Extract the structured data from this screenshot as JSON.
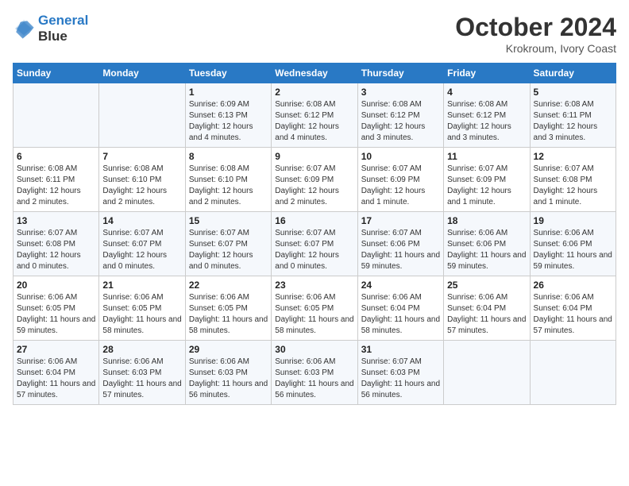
{
  "header": {
    "logo_line1": "General",
    "logo_line2": "Blue",
    "month": "October 2024",
    "location": "Krokroum, Ivory Coast"
  },
  "weekdays": [
    "Sunday",
    "Monday",
    "Tuesday",
    "Wednesday",
    "Thursday",
    "Friday",
    "Saturday"
  ],
  "weeks": [
    [
      {
        "day": "",
        "sunrise": "",
        "sunset": "",
        "daylight": ""
      },
      {
        "day": "",
        "sunrise": "",
        "sunset": "",
        "daylight": ""
      },
      {
        "day": "1",
        "sunrise": "Sunrise: 6:09 AM",
        "sunset": "Sunset: 6:13 PM",
        "daylight": "Daylight: 12 hours and 4 minutes."
      },
      {
        "day": "2",
        "sunrise": "Sunrise: 6:08 AM",
        "sunset": "Sunset: 6:12 PM",
        "daylight": "Daylight: 12 hours and 4 minutes."
      },
      {
        "day": "3",
        "sunrise": "Sunrise: 6:08 AM",
        "sunset": "Sunset: 6:12 PM",
        "daylight": "Daylight: 12 hours and 3 minutes."
      },
      {
        "day": "4",
        "sunrise": "Sunrise: 6:08 AM",
        "sunset": "Sunset: 6:12 PM",
        "daylight": "Daylight: 12 hours and 3 minutes."
      },
      {
        "day": "5",
        "sunrise": "Sunrise: 6:08 AM",
        "sunset": "Sunset: 6:11 PM",
        "daylight": "Daylight: 12 hours and 3 minutes."
      }
    ],
    [
      {
        "day": "6",
        "sunrise": "Sunrise: 6:08 AM",
        "sunset": "Sunset: 6:11 PM",
        "daylight": "Daylight: 12 hours and 2 minutes."
      },
      {
        "day": "7",
        "sunrise": "Sunrise: 6:08 AM",
        "sunset": "Sunset: 6:10 PM",
        "daylight": "Daylight: 12 hours and 2 minutes."
      },
      {
        "day": "8",
        "sunrise": "Sunrise: 6:08 AM",
        "sunset": "Sunset: 6:10 PM",
        "daylight": "Daylight: 12 hours and 2 minutes."
      },
      {
        "day": "9",
        "sunrise": "Sunrise: 6:07 AM",
        "sunset": "Sunset: 6:09 PM",
        "daylight": "Daylight: 12 hours and 2 minutes."
      },
      {
        "day": "10",
        "sunrise": "Sunrise: 6:07 AM",
        "sunset": "Sunset: 6:09 PM",
        "daylight": "Daylight: 12 hours and 1 minute."
      },
      {
        "day": "11",
        "sunrise": "Sunrise: 6:07 AM",
        "sunset": "Sunset: 6:09 PM",
        "daylight": "Daylight: 12 hours and 1 minute."
      },
      {
        "day": "12",
        "sunrise": "Sunrise: 6:07 AM",
        "sunset": "Sunset: 6:08 PM",
        "daylight": "Daylight: 12 hours and 1 minute."
      }
    ],
    [
      {
        "day": "13",
        "sunrise": "Sunrise: 6:07 AM",
        "sunset": "Sunset: 6:08 PM",
        "daylight": "Daylight: 12 hours and 0 minutes."
      },
      {
        "day": "14",
        "sunrise": "Sunrise: 6:07 AM",
        "sunset": "Sunset: 6:07 PM",
        "daylight": "Daylight: 12 hours and 0 minutes."
      },
      {
        "day": "15",
        "sunrise": "Sunrise: 6:07 AM",
        "sunset": "Sunset: 6:07 PM",
        "daylight": "Daylight: 12 hours and 0 minutes."
      },
      {
        "day": "16",
        "sunrise": "Sunrise: 6:07 AM",
        "sunset": "Sunset: 6:07 PM",
        "daylight": "Daylight: 12 hours and 0 minutes."
      },
      {
        "day": "17",
        "sunrise": "Sunrise: 6:07 AM",
        "sunset": "Sunset: 6:06 PM",
        "daylight": "Daylight: 11 hours and 59 minutes."
      },
      {
        "day": "18",
        "sunrise": "Sunrise: 6:06 AM",
        "sunset": "Sunset: 6:06 PM",
        "daylight": "Daylight: 11 hours and 59 minutes."
      },
      {
        "day": "19",
        "sunrise": "Sunrise: 6:06 AM",
        "sunset": "Sunset: 6:06 PM",
        "daylight": "Daylight: 11 hours and 59 minutes."
      }
    ],
    [
      {
        "day": "20",
        "sunrise": "Sunrise: 6:06 AM",
        "sunset": "Sunset: 6:05 PM",
        "daylight": "Daylight: 11 hours and 59 minutes."
      },
      {
        "day": "21",
        "sunrise": "Sunrise: 6:06 AM",
        "sunset": "Sunset: 6:05 PM",
        "daylight": "Daylight: 11 hours and 58 minutes."
      },
      {
        "day": "22",
        "sunrise": "Sunrise: 6:06 AM",
        "sunset": "Sunset: 6:05 PM",
        "daylight": "Daylight: 11 hours and 58 minutes."
      },
      {
        "day": "23",
        "sunrise": "Sunrise: 6:06 AM",
        "sunset": "Sunset: 6:05 PM",
        "daylight": "Daylight: 11 hours and 58 minutes."
      },
      {
        "day": "24",
        "sunrise": "Sunrise: 6:06 AM",
        "sunset": "Sunset: 6:04 PM",
        "daylight": "Daylight: 11 hours and 58 minutes."
      },
      {
        "day": "25",
        "sunrise": "Sunrise: 6:06 AM",
        "sunset": "Sunset: 6:04 PM",
        "daylight": "Daylight: 11 hours and 57 minutes."
      },
      {
        "day": "26",
        "sunrise": "Sunrise: 6:06 AM",
        "sunset": "Sunset: 6:04 PM",
        "daylight": "Daylight: 11 hours and 57 minutes."
      }
    ],
    [
      {
        "day": "27",
        "sunrise": "Sunrise: 6:06 AM",
        "sunset": "Sunset: 6:04 PM",
        "daylight": "Daylight: 11 hours and 57 minutes."
      },
      {
        "day": "28",
        "sunrise": "Sunrise: 6:06 AM",
        "sunset": "Sunset: 6:03 PM",
        "daylight": "Daylight: 11 hours and 57 minutes."
      },
      {
        "day": "29",
        "sunrise": "Sunrise: 6:06 AM",
        "sunset": "Sunset: 6:03 PM",
        "daylight": "Daylight: 11 hours and 56 minutes."
      },
      {
        "day": "30",
        "sunrise": "Sunrise: 6:06 AM",
        "sunset": "Sunset: 6:03 PM",
        "daylight": "Daylight: 11 hours and 56 minutes."
      },
      {
        "day": "31",
        "sunrise": "Sunrise: 6:07 AM",
        "sunset": "Sunset: 6:03 PM",
        "daylight": "Daylight: 11 hours and 56 minutes."
      },
      {
        "day": "",
        "sunrise": "",
        "sunset": "",
        "daylight": ""
      },
      {
        "day": "",
        "sunrise": "",
        "sunset": "",
        "daylight": ""
      }
    ]
  ]
}
